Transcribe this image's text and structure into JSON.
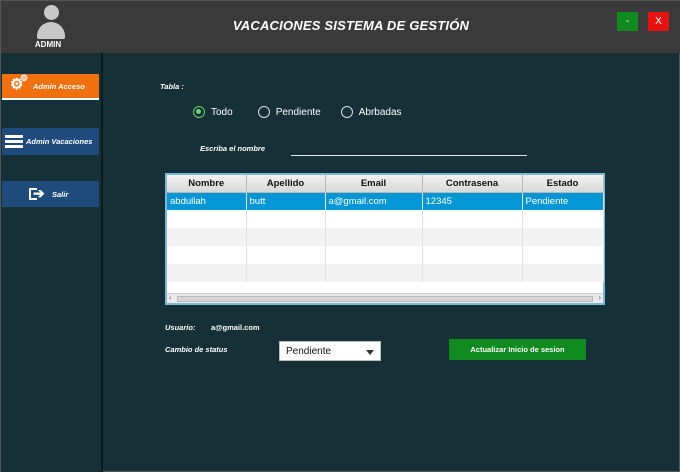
{
  "header": {
    "user_label": "ADMIN",
    "title": "VACACIONES SISTEMA DE GESTIÓN",
    "minimize_label": "-",
    "close_label": "X"
  },
  "sidebar": {
    "items": [
      {
        "label": "Admin Acceso",
        "icon": "gears-icon",
        "active": true
      },
      {
        "label": "Admin Vacaciones",
        "icon": "list-icon",
        "active": false
      },
      {
        "label": "Salir",
        "icon": "exit-icon",
        "active": false
      }
    ]
  },
  "filter": {
    "table_label": "Tabla :",
    "options": [
      "Todo",
      "Pendiente",
      "Abrbadas"
    ],
    "selected": "Todo",
    "name_label": "Escriba el nombre",
    "name_value": ""
  },
  "table": {
    "columns": [
      "Nombre",
      "Apellido",
      "Email",
      "Contrasena",
      "Estado"
    ],
    "rows": [
      [
        "abdullah",
        "butt",
        "a@gmail.com",
        "12345",
        "Pendiente"
      ]
    ]
  },
  "details": {
    "usuario_label": "Usuario:",
    "usuario_value": "a@gmail.com",
    "status_label": "Cambio de status",
    "status_value": "Pendiente",
    "update_button": "Actualizar Inicio de sesion"
  },
  "colors": {
    "background": "#153037",
    "titlebar": "#3a3a3a",
    "active_nav": "#f07010",
    "nav": "#1f4b7c",
    "accent_green": "#118a1f",
    "close_red": "#e51212",
    "selection": "#0597d5"
  }
}
